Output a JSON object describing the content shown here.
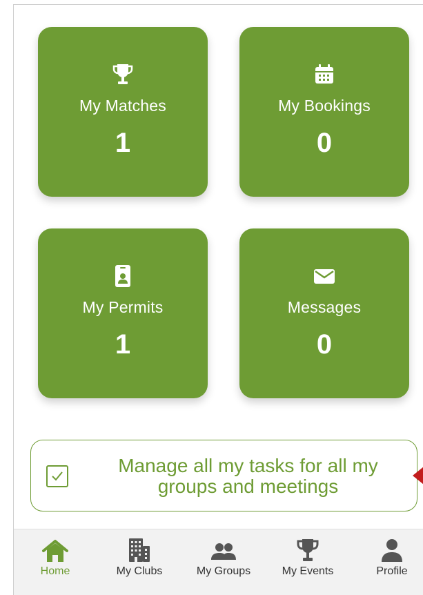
{
  "tiles": {
    "matches": {
      "label": "My Matches",
      "count": "1",
      "icon": "trophy-icon"
    },
    "bookings": {
      "label": "My Bookings",
      "count": "0",
      "icon": "calendar-icon"
    },
    "permits": {
      "label": "My Permits",
      "count": "1",
      "icon": "id-badge-icon"
    },
    "messages": {
      "label": "Messages",
      "count": "0",
      "icon": "envelope-icon"
    }
  },
  "tasks": {
    "label": "Manage all my tasks for all my groups and meetings",
    "icon": "checkbox-checked-icon"
  },
  "tabbar": {
    "active": "Home",
    "items": [
      {
        "label": "Home",
        "icon": "home-icon"
      },
      {
        "label": "My Clubs",
        "icon": "building-icon"
      },
      {
        "label": "My Groups",
        "icon": "group-icon"
      },
      {
        "label": "My Events",
        "icon": "trophy-icon"
      },
      {
        "label": "Profile",
        "icon": "person-icon"
      }
    ]
  },
  "colors": {
    "accent": "#6e9c34",
    "tab_icon": "#555555",
    "pointer": "#c21d1d"
  }
}
